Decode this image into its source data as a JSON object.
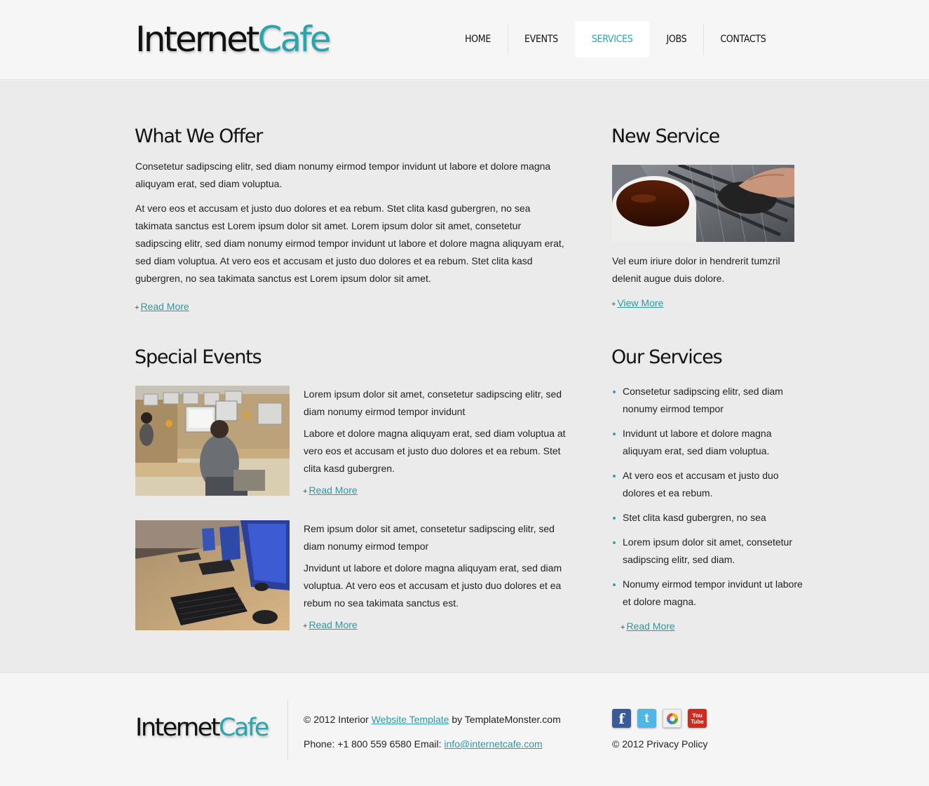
{
  "header": {
    "logo_part1": "Internet",
    "logo_part2": "Cafe",
    "nav": [
      "HOME",
      "EVENTS",
      "SERVICES",
      "JOBS",
      "CONTACTS"
    ],
    "active_nav": "SERVICES"
  },
  "offer": {
    "title": "What We Offer",
    "intro": "Consetetur sadipscing elitr, sed diam nonumy eirmod tempor invidunt ut labore et dolore magna aliquyam erat, sed diam voluptua.",
    "body": "At vero eos et accusam et justo duo dolores et ea rebum. Stet clita kasd gubergren, no sea takimata sanctus est Lorem ipsum dolor sit amet. Lorem ipsum dolor sit amet, consetetur sadipscing elitr, sed diam nonumy eirmod tempor invidunt ut labore et dolore magna aliquyam erat, sed diam voluptua. At vero eos et accusam et justo duo dolores et ea rebum. Stet clita kasd gubergren, no sea takimata sanctus est Lorem ipsum dolor sit amet.",
    "more_plus": "+",
    "more": "Read More"
  },
  "new_service": {
    "title": "New Service",
    "text": "Vel eum iriure dolor in hendrerit tumzril delenit augue duis dolore.",
    "more_plus": "+",
    "more": "View More"
  },
  "events": {
    "title": "Special Events",
    "items": [
      {
        "lead": "Lorem ipsum dolor sit amet, consetetur sadipscing elitr, sed diam nonumy eirmod tempor invidunt",
        "body": "Labore et dolore magna aliquyam erat, sed diam voluptua at vero eos et accusam et justo duo dolores et ea rebum. Stet clita kasd gubergren.",
        "more_plus": "+",
        "more": "Read More"
      },
      {
        "lead": "Rem ipsum dolor sit amet, consetetur sadipscing elitr, sed diam nonumy eirmod tempor",
        "body": "Jnvidunt ut labore et dolore magna aliquyam erat, sed diam voluptua. At vero eos et accusam et justo duo dolores et ea rebum no sea takimata sanctus est.",
        "more_plus": "+",
        "more": "Read More"
      }
    ]
  },
  "our_services": {
    "title": "Our Services",
    "items": [
      "Consetetur sadipscing elitr, sed diam nonumy eirmod tempor",
      "Invidunt ut labore et dolore magna aliquyam erat, sed diam voluptua.",
      "At vero eos et accusam et justo duo dolores et ea rebum.",
      "Stet clita kasd gubergren, no sea",
      "Lorem ipsum dolor sit amet, consetetur sadipscing elitr, sed diam.",
      "Nonumy eirmod tempor invidunt ut labore et dolore magna."
    ],
    "more_plus": "+",
    "more": "Read More"
  },
  "footer": {
    "logo_part1": "Internet",
    "logo_part2": "Cafe",
    "copyright_prefix": "© 2012 Interior ",
    "template_link": "Website Template",
    "copyright_suffix": " by TemplateMonster.com",
    "phone": "Phone: +1 800 559 6580 Email: ",
    "email": "info@internetcafe.com",
    "privacy": "© 2012 Privacy Policy",
    "social": {
      "facebook": "f",
      "twitter": "t",
      "youtube_1": "You",
      "youtube_2": "Tube"
    }
  },
  "colors": {
    "accent": "#2ba5ad",
    "link": "#2a9aa1",
    "text": "#222222"
  }
}
